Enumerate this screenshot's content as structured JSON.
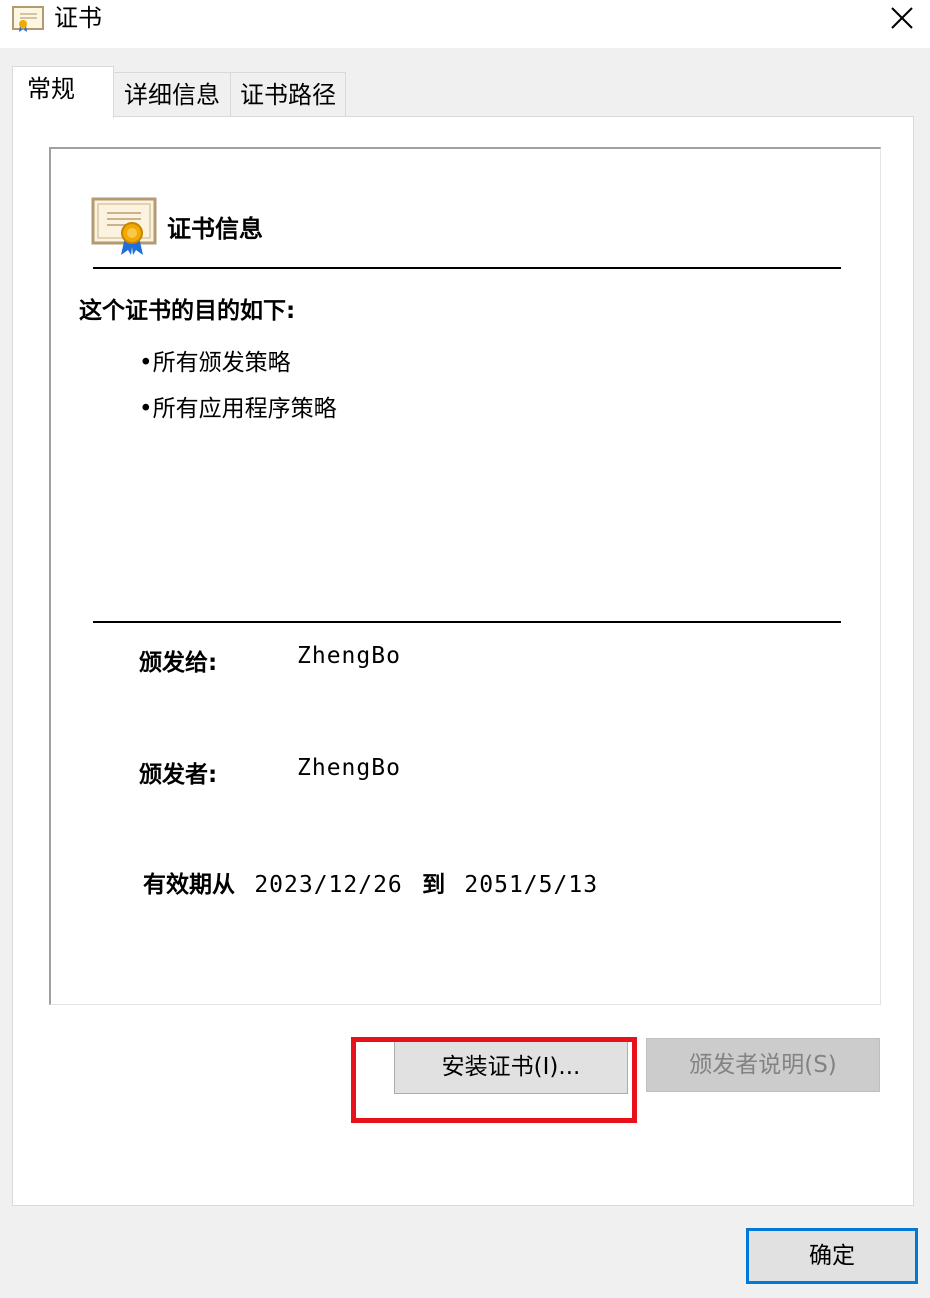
{
  "window": {
    "title": "证书",
    "icon": "certificate-icon",
    "close_icon": "close-icon"
  },
  "tabs": [
    {
      "label": "常规",
      "active": true
    },
    {
      "label": "详细信息",
      "active": false
    },
    {
      "label": "证书路径",
      "active": false
    }
  ],
  "cert_info": {
    "heading": "证书信息",
    "purpose_title": "这个证书的目的如下:",
    "purposes": [
      "•所有颁发策略",
      "•所有应用程序策略"
    ],
    "issued_to_label": "颁发给:",
    "issued_to_value": "ZhengBo",
    "issued_by_label": "颁发者:",
    "issued_by_value": "ZhengBo",
    "valid_from_label": "有效期从",
    "valid_from": "2023/12/26",
    "valid_to_label": "到",
    "valid_to": "2051/5/13"
  },
  "buttons": {
    "install": "安装证书(I)...",
    "issuer_statement": "颁发者说明(S)",
    "ok": "确定"
  },
  "colors": {
    "highlight": "#e8101a",
    "focus_border": "#0078d7",
    "ribbon_gold": "#f2a900",
    "ribbon_blue": "#1f6fd6"
  }
}
